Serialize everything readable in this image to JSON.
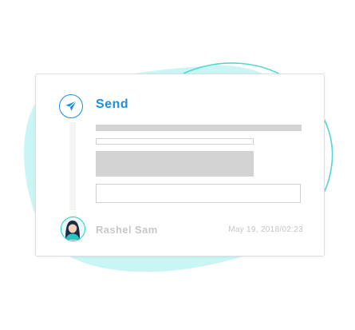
{
  "card": {
    "title": "Send",
    "author": "Rashel Sam",
    "datetime": "May 19, 2018/02:23"
  },
  "colors": {
    "accent": "#1a8fe3",
    "blob_fill": "#c9f6f5",
    "blob_stroke": "#4fd8d2",
    "placeholder_gray": "#d3d3d3",
    "muted_text": "#c8c8c8"
  },
  "icons": {
    "send": "paper-plane-icon",
    "avatar": "avatar"
  }
}
